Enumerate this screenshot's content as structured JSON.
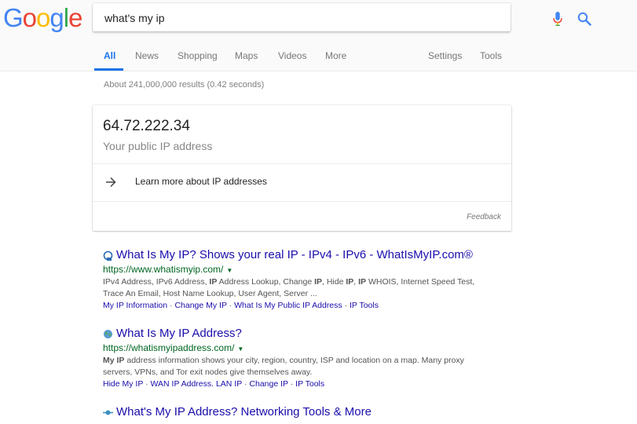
{
  "header": {
    "logo_letters": [
      "G",
      "o",
      "o",
      "g",
      "l",
      "e"
    ],
    "logo_colors": [
      "#4285F4",
      "#EA4335",
      "#FBBC05",
      "#4285F4",
      "#34A853",
      "#EA4335"
    ],
    "query": "what's my ip"
  },
  "tabs": {
    "items": [
      "All",
      "News",
      "Shopping",
      "Maps",
      "Videos",
      "More"
    ],
    "settings": "Settings",
    "tools": "Tools",
    "active": "All"
  },
  "stats": "About 241,000,000 results (0.42 seconds)",
  "ip_card": {
    "ip": "64.72.222.34",
    "caption": "Your public IP address",
    "learn_more": "Learn more about IP addresses",
    "feedback": "Feedback"
  },
  "results": [
    {
      "title": "What Is My IP? Shows your real IP - IPv4 - IPv6 - WhatIsMyIP.com®",
      "url": "https://www.whatismyip.com/",
      "snippet_html": "IPv4 Address, IPv6 Address, <b>IP</b> Address Lookup, Change <b>IP</b>, Hide <b>IP</b>, <b>IP</b> WHOIS, Internet Speed Test,<br>Trace An Email, Host Name Lookup, User Agent, Server ...",
      "links": [
        "My IP Information",
        "Change My IP",
        "What Is My Public IP Address",
        "IP Tools"
      ]
    },
    {
      "title": "What Is My IP Address?",
      "url": "https://whatismyipaddress.com/",
      "snippet_html": "<b>My IP</b> address information shows your city, region, country, ISP and location on a map. Many proxy<br>servers, VPNs, and Tor exit nodes give themselves away.",
      "links": [
        "Hide My IP",
        "WAN IP Address. LAN IP",
        "Change IP",
        "IP Tools"
      ]
    },
    {
      "title": "What's My IP Address? Networking Tools & More"
    }
  ],
  "colors": {
    "accent": "#1a73e8",
    "link": "#1a0dab",
    "url": "#006621",
    "snippet": "#545454"
  }
}
